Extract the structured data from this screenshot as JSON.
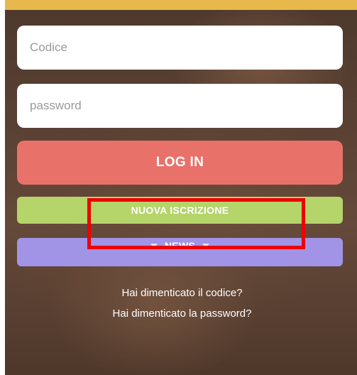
{
  "login_form": {
    "code_field": {
      "placeholder": "Codice",
      "value": ""
    },
    "password_field": {
      "placeholder": "password",
      "value": ""
    },
    "login_button": "LOG IN",
    "new_registration_button": "NUOVA ISCRIZIONE",
    "news_button": {
      "label": "NEWS",
      "icon": "chevron-down-icon"
    },
    "forgot_code_link": "Hai dimenticato il codice?",
    "forgot_password_link": "Hai dimenticato la password?"
  },
  "colors": {
    "top_bar": "#e8b84c",
    "login_button": "#e8726a",
    "new_registration_button": "#b5d46a",
    "news_button": "#a194e6",
    "highlight_box": "#ee0000"
  }
}
